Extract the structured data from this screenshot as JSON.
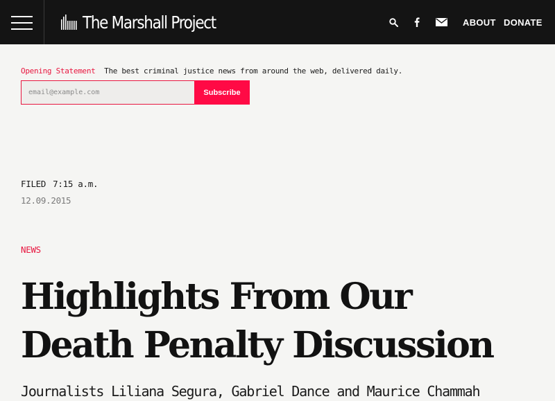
{
  "header": {
    "brand": "The Marshall Project",
    "icons": [
      "menu-icon",
      "brand-logo-bars",
      "search-icon",
      "facebook-icon",
      "mail-icon"
    ],
    "nav": {
      "about": "ABOUT",
      "donate": "DONATE"
    }
  },
  "newsletter": {
    "name": "Opening Statement",
    "tagline": "The best criminal justice news from around the web, delivered daily.",
    "email_placeholder": "email@example.com",
    "subscribe_label": "Subscribe"
  },
  "article": {
    "filed_label": "FILED",
    "filed_time": "7:15 a.m.",
    "filed_date": "12.09.2015",
    "category": "NEWS",
    "headline": "Highlights From Our Death Penalty Discussion",
    "dek": "Journalists Liliana Segura, Gabriel Dance and Maurice Chammah"
  },
  "colors": {
    "header_bg": "#141414",
    "page_bg": "#f5f5f3",
    "accent": "#e8163f",
    "subscribe_bg": "#ff0a45"
  }
}
